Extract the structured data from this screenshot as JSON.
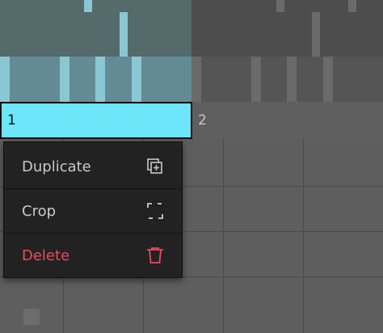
{
  "scenes": [
    {
      "label": "1",
      "selected": true
    },
    {
      "label": "2",
      "selected": false
    }
  ],
  "context_menu": {
    "items": [
      {
        "label": "Duplicate",
        "icon": "duplicate-icon"
      },
      {
        "label": "Crop",
        "icon": "crop-icon"
      },
      {
        "label": "Delete",
        "icon": "trash-icon",
        "color": "#ef4a5a"
      }
    ]
  },
  "colors": {
    "selected_scene": "#6ce6f8",
    "menu_background": "#222222",
    "delete": "#ef4a5a"
  }
}
